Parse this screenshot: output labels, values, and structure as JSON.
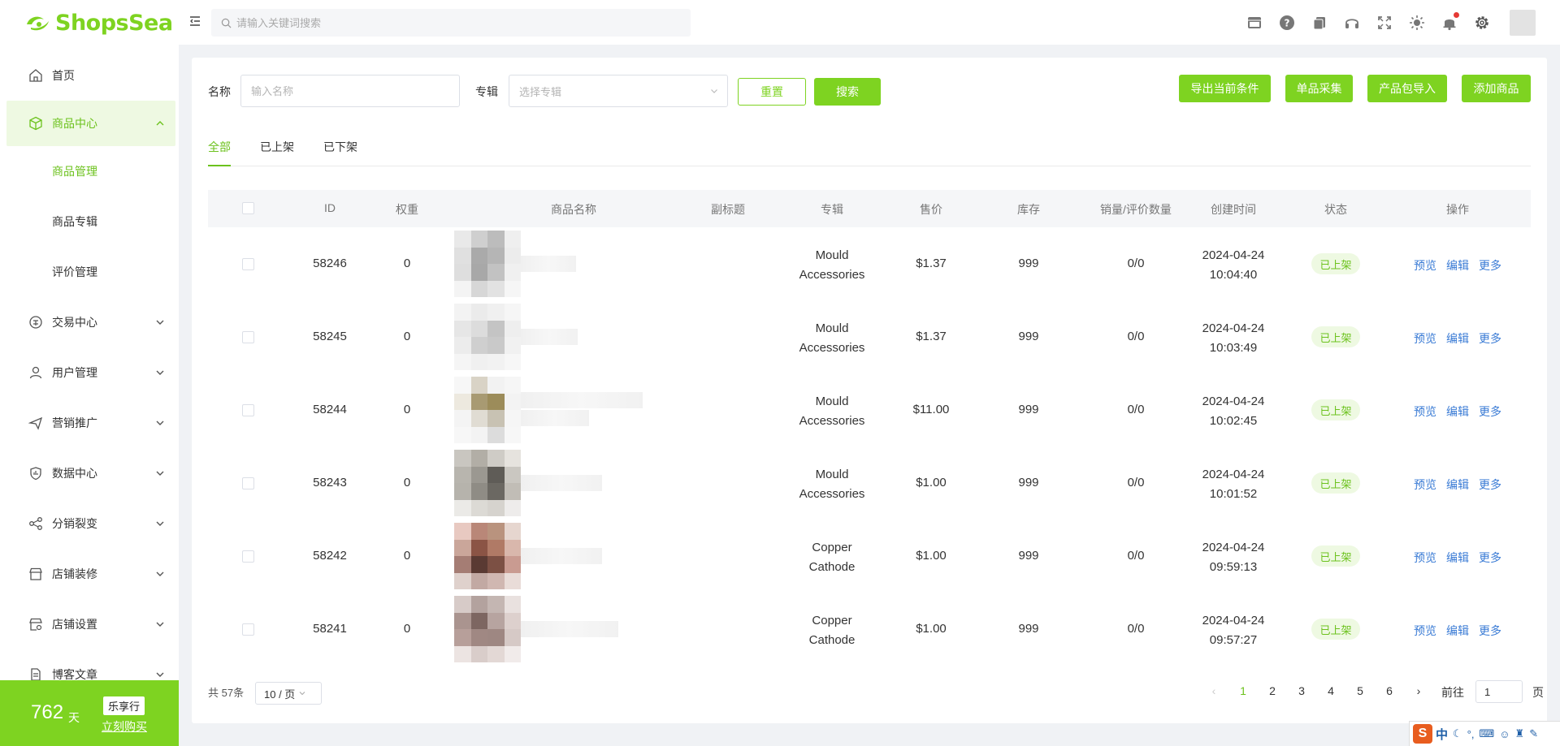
{
  "app": {
    "logo_text": "ShopsSea"
  },
  "topbar": {
    "search_placeholder": "请输入关键词搜索"
  },
  "sidebar": {
    "items": [
      {
        "label": "首页"
      },
      {
        "label": "商品中心"
      },
      {
        "label": "交易中心"
      },
      {
        "label": "用户管理"
      },
      {
        "label": "营销推广"
      },
      {
        "label": "数据中心"
      },
      {
        "label": "分销裂变"
      },
      {
        "label": "店铺装修"
      },
      {
        "label": "店铺设置"
      },
      {
        "label": "博客文章"
      }
    ],
    "sub_items": [
      {
        "label": "商品管理"
      },
      {
        "label": "商品专辑"
      },
      {
        "label": "评价管理"
      }
    ],
    "promo": {
      "days": "762",
      "unit": "天",
      "badge": "乐享行",
      "link": "立刻购买"
    }
  },
  "filters": {
    "name_label": "名称",
    "name_placeholder": "输入名称",
    "album_label": "专辑",
    "album_placeholder": "选择专辑",
    "reset": "重置",
    "search": "搜索",
    "actions": [
      "导出当前条件",
      "单品采集",
      "产品包导入",
      "添加商品"
    ]
  },
  "tabs": [
    "全部",
    "已上架",
    "已下架"
  ],
  "table": {
    "headers": [
      "ID",
      "权重",
      "商品名称",
      "副标题",
      "专辑",
      "售价",
      "库存",
      "销量/评价数量",
      "创建时间",
      "状态",
      "操作"
    ],
    "ops": [
      "预览",
      "编辑",
      "更多"
    ],
    "rows": [
      {
        "id": "58246",
        "weight": "0",
        "album1": "Mould",
        "album2": "Accessories",
        "price": "$1.37",
        "stock": "999",
        "sales": "0/0",
        "date": "2024-04-24",
        "time": "10:04:40",
        "status": "已上架"
      },
      {
        "id": "58245",
        "weight": "0",
        "album1": "Mould",
        "album2": "Accessories",
        "price": "$1.37",
        "stock": "999",
        "sales": "0/0",
        "date": "2024-04-24",
        "time": "10:03:49",
        "status": "已上架"
      },
      {
        "id": "58244",
        "weight": "0",
        "album1": "Mould",
        "album2": "Accessories",
        "price": "$11.00",
        "stock": "999",
        "sales": "0/0",
        "date": "2024-04-24",
        "time": "10:02:45",
        "status": "已上架"
      },
      {
        "id": "58243",
        "weight": "0",
        "album1": "Mould",
        "album2": "Accessories",
        "price": "$1.00",
        "stock": "999",
        "sales": "0/0",
        "date": "2024-04-24",
        "time": "10:01:52",
        "status": "已上架"
      },
      {
        "id": "58242",
        "weight": "0",
        "album1": "Copper",
        "album2": "Cathode",
        "price": "$1.00",
        "stock": "999",
        "sales": "0/0",
        "date": "2024-04-24",
        "time": "09:59:13",
        "status": "已上架"
      },
      {
        "id": "58241",
        "weight": "0",
        "album1": "Copper",
        "album2": "Cathode",
        "price": "$1.00",
        "stock": "999",
        "sales": "0/0",
        "date": "2024-04-24",
        "time": "09:57:27",
        "status": "已上架"
      }
    ]
  },
  "pagination": {
    "total": "共 57条",
    "page_size": "10 / 页",
    "pages": [
      "1",
      "2",
      "3",
      "4",
      "5",
      "6"
    ],
    "goto_label": "前往",
    "goto_value": "1",
    "page_suffix": "页"
  },
  "ime": {
    "logo": "S",
    "lang": "中"
  },
  "colors": {
    "accent": "#7ed321",
    "accent_text": "#6cc21d",
    "link": "#3a7bd5"
  }
}
